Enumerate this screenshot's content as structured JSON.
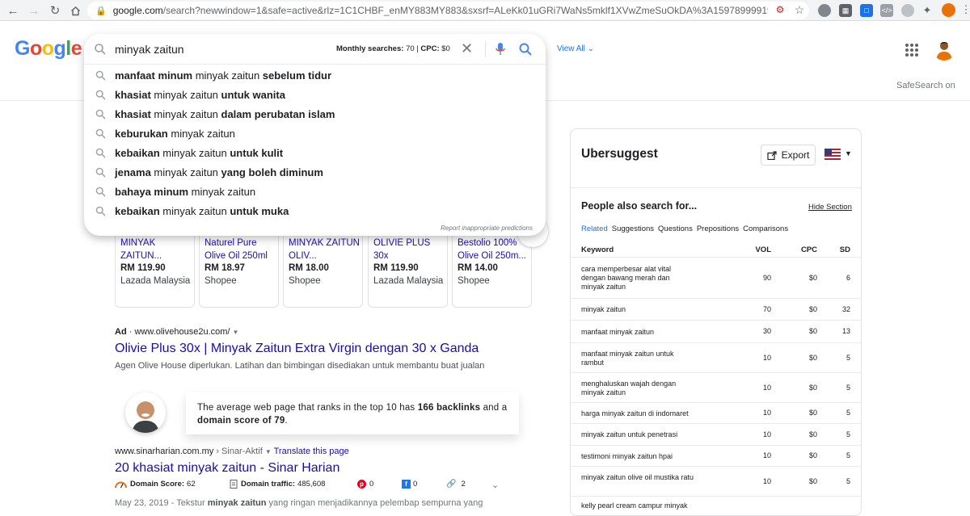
{
  "browser": {
    "url_host": "google.com",
    "url_rest": "/search?newwindow=1&safe=active&rlz=1C1CHBF_enMY883MY883&sxsrf=ALeKk01uGRi7WaNs5mklf1XVwZmeSuOkDA%3A1597899991977&ei=1wQ-..."
  },
  "google": {
    "logo_letters": [
      "G",
      "o",
      "o",
      "g",
      "l",
      "e"
    ],
    "view_all": "View All",
    "safesearch": "SafeSearch on"
  },
  "search": {
    "query": "minyak zaitun",
    "monthly_label": "Monthly searches:",
    "monthly_value": "70",
    "cpc_label": "CPC:",
    "cpc_value": "$0",
    "report": "Report inappropriate predictions",
    "suggestions": [
      [
        [
          "manfaat minum",
          true
        ],
        [
          " minyak zaitun ",
          false
        ],
        [
          "sebelum tidur",
          true
        ]
      ],
      [
        [
          "khasiat",
          true
        ],
        [
          " minyak zaitun ",
          false
        ],
        [
          "untuk wanita",
          true
        ]
      ],
      [
        [
          "khasiat",
          true
        ],
        [
          " minyak zaitun ",
          false
        ],
        [
          "dalam perubatan islam",
          true
        ]
      ],
      [
        [
          "keburukan",
          true
        ],
        [
          " minyak zaitun",
          false
        ]
      ],
      [
        [
          "kebaikan",
          true
        ],
        [
          " minyak zaitun ",
          false
        ],
        [
          "untuk kulit",
          true
        ]
      ],
      [
        [
          "jenama",
          true
        ],
        [
          " minyak zaitun ",
          false
        ],
        [
          "yang boleh diminum",
          true
        ]
      ],
      [
        [
          "bahaya minum",
          true
        ],
        [
          " minyak zaitun",
          false
        ]
      ],
      [
        [
          "kebaikan",
          true
        ],
        [
          " minyak zaitun ",
          false
        ],
        [
          "untuk muka",
          true
        ]
      ]
    ]
  },
  "shopping": [
    {
      "title": "MINYAK ZAITUN...",
      "price": "RM 119.90",
      "store": "Lazada Malaysia"
    },
    {
      "title": "Naturel Pure Olive Oil 250ml",
      "price": "RM 18.97",
      "store": "Shopee"
    },
    {
      "title": "MINYAK ZAITUN OLIV...",
      "price": "RM 18.00",
      "store": "Shopee"
    },
    {
      "title": "OLIVIE PLUS 30x",
      "price": "RM 119.90",
      "store": "Lazada Malaysia"
    },
    {
      "title": "Bestolio 100% Olive Oil 250m...",
      "price": "RM 14.00",
      "store": "Shopee"
    }
  ],
  "ad": {
    "label": "Ad",
    "url": "www.olivehouse2u.com/",
    "title": "Olivie Plus 30x | Minyak Zaitun Extra Virgin dengan 30 x Ganda",
    "desc": "Agen Olive House diperlukan. Latihan dan bimbingan disediakan untuk membantu buat jualan"
  },
  "tooltip": {
    "pre": "The average web page that ranks in the top 10 has ",
    "backlinks": "166 backlinks",
    "mid": " and a ",
    "domain_score": "domain score of 79",
    "post": "."
  },
  "organic": {
    "site": "www.sinarharian.com.my",
    "path": " › Sinar-Aktif ",
    "translate": "Translate this page",
    "title": "20 khasiat minyak zaitun - Sinar Harian",
    "domain_score_label": "Domain Score:",
    "domain_score": "62",
    "domain_traffic_label": "Domain traffic:",
    "domain_traffic": "485,608",
    "pinterest": "0",
    "facebook": "0",
    "links": "2",
    "snippet_date": "May 23, 2019 - Tekstur ",
    "snippet_bold": "minyak zaitun",
    "snippet_rest": " yang ringan menjadikannya pelembap sempurna yang"
  },
  "uber": {
    "title": "Ubersuggest",
    "export": "Export",
    "section_title": "People also search for...",
    "hide": "Hide Section",
    "tabs": [
      "Related",
      "Suggestions",
      "Questions",
      "Prepositions",
      "Comparisons"
    ],
    "columns": {
      "keyword": "Keyword",
      "vol": "VOL",
      "cpc": "CPC",
      "sd": "SD"
    },
    "rows": [
      {
        "kw": "cara memperbesar alat vital dengan bawang merah dan minyak zaitun",
        "vol": "90",
        "cpc": "$0",
        "sd": "6"
      },
      {
        "kw": "minyak zaitun",
        "vol": "70",
        "cpc": "$0",
        "sd": "32"
      },
      {
        "kw": "manfaat minyak zaitun",
        "vol": "30",
        "cpc": "$0",
        "sd": "13"
      },
      {
        "kw": "manfaat minyak zaitun untuk rambut",
        "vol": "10",
        "cpc": "$0",
        "sd": "5"
      },
      {
        "kw": "menghaluskan wajah dengan minyak zaitun",
        "vol": "10",
        "cpc": "$0",
        "sd": "5"
      },
      {
        "kw": "harga minyak zaitun di indomaret",
        "vol": "10",
        "cpc": "$0",
        "sd": "5"
      },
      {
        "kw": "minyak zaitun untuk penetrasi",
        "vol": "10",
        "cpc": "$0",
        "sd": "5"
      },
      {
        "kw": "testimoni minyak zaitun hpai",
        "vol": "10",
        "cpc": "$0",
        "sd": "5"
      },
      {
        "kw": "minyak zaitun olive oil mustika ratu",
        "vol": "10",
        "cpc": "$0",
        "sd": "5"
      },
      {
        "kw": "kelly pearl cream campur minyak",
        "vol": "",
        "cpc": "",
        "sd": ""
      }
    ]
  }
}
